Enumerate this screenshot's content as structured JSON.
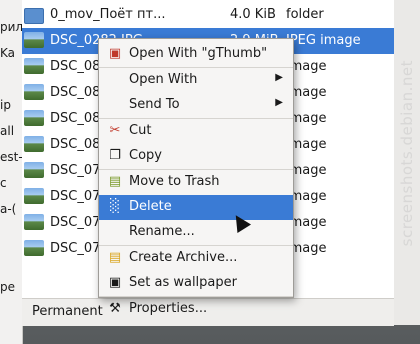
{
  "left_strip": [
    "рил",
    "Ka",
    "",
    "ip",
    "all",
    "est-",
    "c",
    "a-(",
    "",
    "",
    "pe",
    ""
  ],
  "files": [
    {
      "name": "0_mov_Поёт пт...",
      "size": "4.0 KiB",
      "type": "folder",
      "kind": "folder",
      "selected": false
    },
    {
      "name": "DSC_0282.JPG",
      "size": "2.9 MiB",
      "type": "JPEG image",
      "kind": "photo",
      "selected": true
    },
    {
      "name": "DSC_08",
      "size": "",
      "type": "image",
      "kind": "photo",
      "selected": false
    },
    {
      "name": "DSC_08",
      "size": "",
      "type": "image",
      "kind": "photo",
      "selected": false
    },
    {
      "name": "DSC_08",
      "size": "",
      "type": "image",
      "kind": "photo",
      "selected": false
    },
    {
      "name": "DSC_08",
      "size": "",
      "type": "image",
      "kind": "photo",
      "selected": false
    },
    {
      "name": "DSC_07",
      "size": "",
      "type": "image",
      "kind": "photo",
      "selected": false
    },
    {
      "name": "DSC_07",
      "size": "",
      "type": "image",
      "kind": "photo",
      "selected": false
    },
    {
      "name": "DSC_07",
      "size": "",
      "type": "image",
      "kind": "photo",
      "selected": false
    },
    {
      "name": "DSC_07",
      "size": "",
      "type": "image",
      "kind": "photo",
      "selected": false
    }
  ],
  "statusbar": {
    "text": "Permanent"
  },
  "menu": {
    "items": [
      {
        "label": "Open With \"gThumb\"",
        "icon": "gthumb-icon",
        "glyph": "▣",
        "submenu": false,
        "highlighted": false
      },
      {
        "label": "Open With",
        "icon": "",
        "glyph": "",
        "submenu": true,
        "highlighted": false
      },
      {
        "label": "Send To",
        "icon": "",
        "glyph": "",
        "submenu": true,
        "highlighted": false
      },
      {
        "label": "Cut",
        "icon": "scissors-icon",
        "glyph": "✂",
        "submenu": false,
        "highlighted": false
      },
      {
        "label": "Copy",
        "icon": "copy-icon",
        "glyph": "❐",
        "submenu": false,
        "highlighted": false
      },
      {
        "label": "Move to Trash",
        "icon": "trash-icon",
        "glyph": "▤",
        "submenu": false,
        "highlighted": false
      },
      {
        "label": "Delete",
        "icon": "shredder-icon",
        "glyph": "░",
        "submenu": false,
        "highlighted": true
      },
      {
        "label": "Rename...",
        "icon": "",
        "glyph": "",
        "submenu": false,
        "highlighted": false
      },
      {
        "label": "Create Archive...",
        "icon": "archive-icon",
        "glyph": "▤",
        "submenu": false,
        "highlighted": false
      },
      {
        "label": "Set as wallpaper",
        "icon": "wallpaper-icon",
        "glyph": "▣",
        "submenu": false,
        "highlighted": false
      },
      {
        "label": "Properties...",
        "icon": "properties-icon",
        "glyph": "⚒",
        "submenu": false,
        "highlighted": false
      }
    ]
  },
  "watermark": "screenshots.debian.net",
  "colors": {
    "accent": "#3a7bd5",
    "menu_bg": "#f6f5f4"
  }
}
